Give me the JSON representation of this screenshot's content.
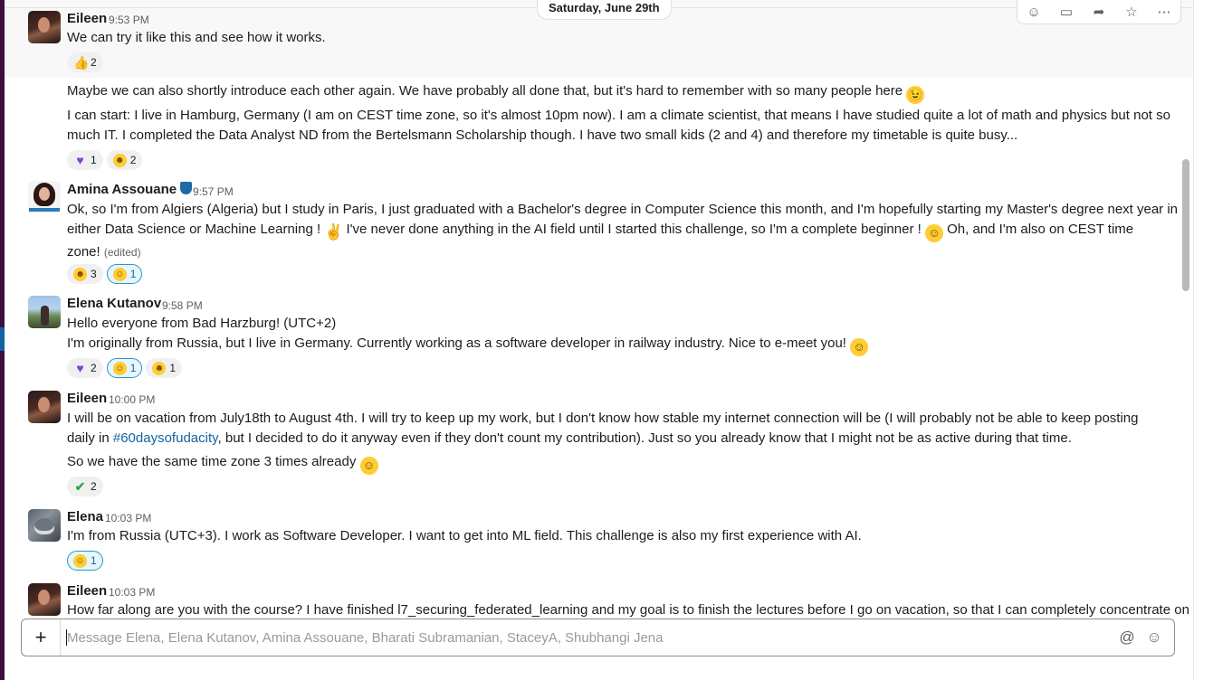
{
  "date_divider": "Saturday, June 29th",
  "message_actions": [
    "add-reaction-icon",
    "reply-in-thread-icon",
    "share-message-icon",
    "save-star-icon",
    "more-actions-icon"
  ],
  "messages": [
    {
      "author": "Eileen",
      "time": "9:53 PM",
      "text": "We can try it like this and see how it works.",
      "reactions": [
        {
          "emoji": "thumbs-up",
          "count": "2"
        }
      ]
    },
    {
      "text_parts": [
        "Maybe we can also shortly introduce each other again. We have probably all done that, but it's hard to remember with so many people here",
        "I can start: I live in Hamburg, Germany (I am on CEST time zone, so it's almost 10pm now). I am a climate scientist, that means I have studied quite a lot of math and physics but not so",
        "much IT. I completed the Data Analyst ND from the Bertelsmann Scholarship though. I have two small kids (2 and 4) and therefore my timetable is quite busy..."
      ],
      "reactions": [
        {
          "emoji": "purple-heart",
          "count": "1"
        },
        {
          "emoji": "grinning",
          "count": "2"
        }
      ]
    },
    {
      "author": "Amina Assouane",
      "time": "9:57 PM",
      "text_lines": [
        "Ok, so I'm from Algiers (Algeria) but I study in Paris, I just graduated with a Bachelor's degree in Computer Science this month, and I'm hopefully starting my Master's degree next year in",
        "either Data Science or Machine Learning !",
        "I've never done anything in the AI field until I started this challenge, so I'm a complete beginner !",
        "Oh, and I'm also on CEST time",
        "zone!"
      ],
      "edited": "(edited)",
      "reactions": [
        {
          "emoji": "grinning",
          "count": "3"
        },
        {
          "emoji": "smiley",
          "count": "1",
          "mine": true
        }
      ]
    },
    {
      "author": "Elena Kutanov",
      "time": "9:58 PM",
      "text_lines": [
        "Hello everyone from Bad Harzburg! (UTC+2)",
        "I'm originally from Russia, but I live in Germany. Currently working as a software developer in railway industry. Nice to e-meet you!"
      ],
      "reactions": [
        {
          "emoji": "purple-heart",
          "count": "2"
        },
        {
          "emoji": "smiley",
          "count": "1",
          "mine": true
        },
        {
          "emoji": "grinning",
          "count": "1"
        }
      ]
    },
    {
      "author": "Eileen",
      "time": "10:00 PM",
      "text_lines": [
        "I will be on vacation from July18th to August 4th. I will try to keep up my work, but I don't know how stable my internet connection will be (I will probably not be able to keep posting",
        "daily in",
        "#60daysofudacity",
        ", but I decided to do it anyway even if they don't count my contribution). Just so you already know that I might not be as active during that time.",
        "So we have the same time zone 3 times already"
      ],
      "reactions": [
        {
          "emoji": "white-check-mark",
          "count": "2"
        }
      ]
    },
    {
      "author": "Elena",
      "time": "10:03 PM",
      "text": "I'm from Russia (UTC+3). I work as Software Developer. I want to get into ML field. This challenge is also my first experience with AI.",
      "reactions": [
        {
          "emoji": "smiley",
          "count": "1",
          "mine": true
        }
      ]
    },
    {
      "author": "Eileen",
      "time": "10:03 PM",
      "text": "How far along are you with the course? I have finished l7_securing_federated_learning and my goal is to finish the lectures before I go on vacation, so that I can completely concentrate on"
    }
  ],
  "composer": {
    "placeholder": "Message Elena, Elena Kutanov, Amina Assouane, Bharati Subramanian, StaceyA, Shubhangi Jena",
    "value": ""
  }
}
